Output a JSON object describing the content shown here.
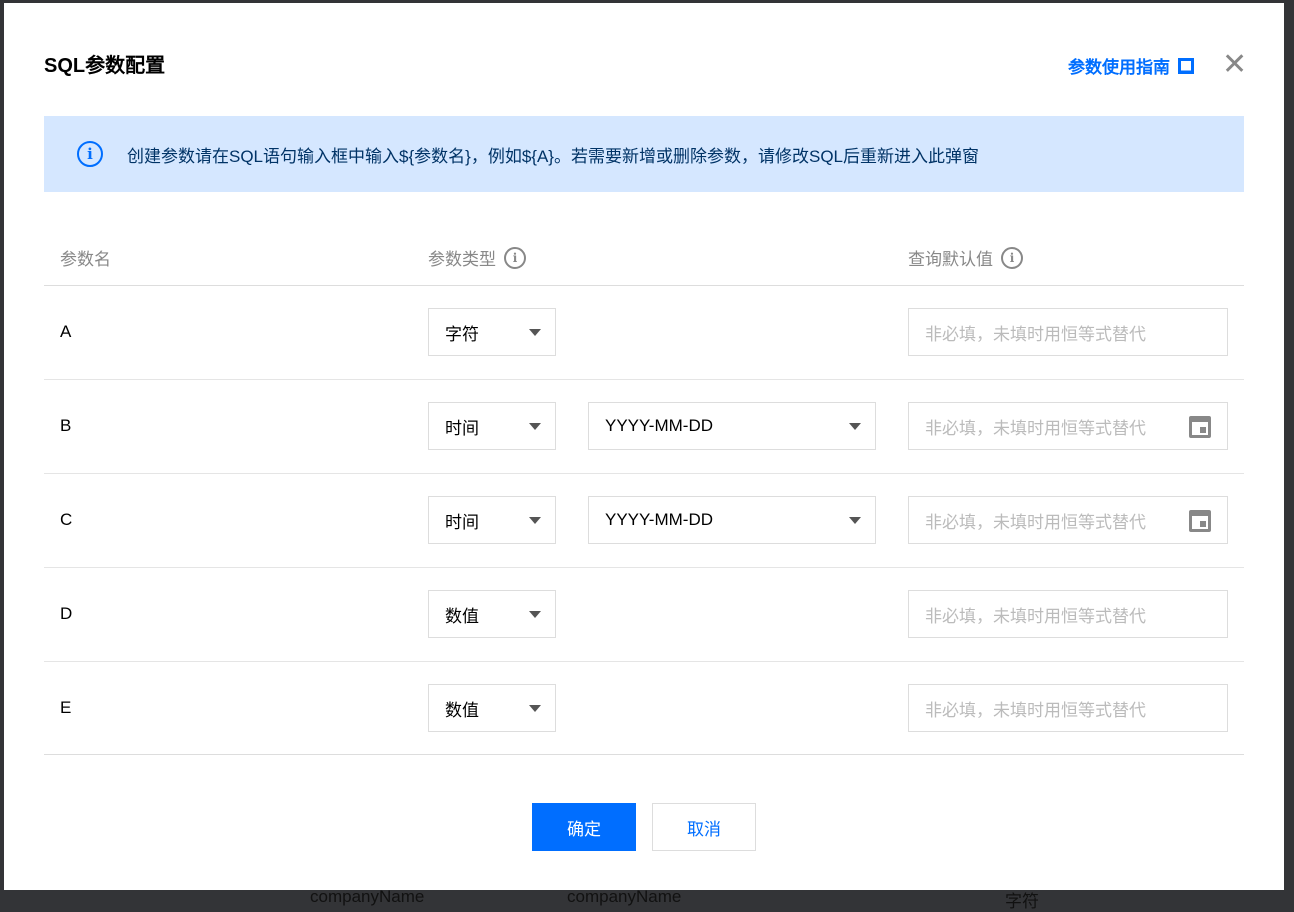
{
  "background": {
    "cells": [
      "companyName",
      "companyName",
      "字符"
    ]
  },
  "dialog": {
    "title": "SQL参数配置",
    "guide_link": "参数使用指南",
    "notice": "创建参数请在SQL语句输入框中输入${参数名}，例如${A}。若需要新增或删除参数，请修改SQL后重新进入此弹窗",
    "headers": {
      "name": "参数名",
      "type": "参数类型",
      "default": "查询默认值"
    },
    "placeholder": "非必填，未填时用恒等式替代",
    "rows": [
      {
        "name": "A",
        "type": "字符"
      },
      {
        "name": "B",
        "type": "时间",
        "format": "YYYY-MM-DD"
      },
      {
        "name": "C",
        "type": "时间",
        "format": "YYYY-MM-DD"
      },
      {
        "name": "D",
        "type": "数值"
      },
      {
        "name": "E",
        "type": "数值"
      }
    ],
    "confirm": "确定",
    "cancel": "取消"
  },
  "colors": {
    "accent": "#006eff",
    "notice_bg": "#d5e7ff"
  }
}
